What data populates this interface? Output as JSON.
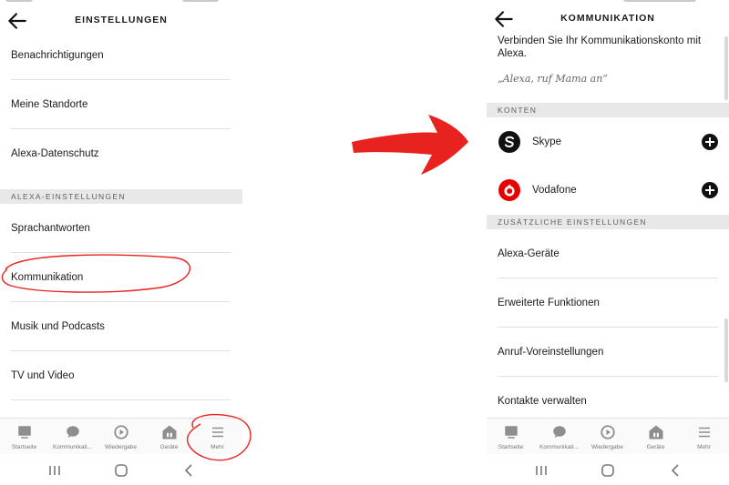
{
  "left": {
    "title": "EINSTELLUNGEN",
    "rows_top": [
      "Benachrichtigungen",
      "Meine Standorte",
      "Alexa-Datenschutz"
    ],
    "section": "ALEXA-EINSTELLUNGEN",
    "rows_bottom": [
      "Sprachantworten",
      "Kommunikation",
      "Musik und Podcasts",
      "TV und Video"
    ]
  },
  "right": {
    "title": "KOMMUNIKATION",
    "intro": "Verbinden Sie Ihr Kommunikationskonto mit Alexa.",
    "quote": "„Alexa, ruf Mama an“",
    "accounts_section": "KONTEN",
    "accounts": [
      "Skype",
      "Vodafone"
    ],
    "more_section": "ZUSÄTZLICHE EINSTELLUNGEN",
    "rows": [
      "Alexa-Geräte",
      "Erweiterte Funktionen",
      "Anruf-Voreinstellungen",
      "Kontakte verwalten"
    ]
  },
  "nav": [
    "Startseite",
    "Kommunikati...",
    "Wiedergabe",
    "Geräte",
    "Mehr"
  ],
  "icons": {
    "nav": [
      "home-icon",
      "chat-bubble-icon",
      "play-icon",
      "devices-icon",
      "menu-icon"
    ],
    "back": "arrow-left-icon",
    "skype": "skype-logo-icon",
    "vodafone": "vodafone-logo-icon",
    "add": "plus-circle-icon"
  },
  "colors": {
    "annotation": "#e8231f",
    "vodafone": "#e60000",
    "section_bg": "#e8e8e8"
  }
}
